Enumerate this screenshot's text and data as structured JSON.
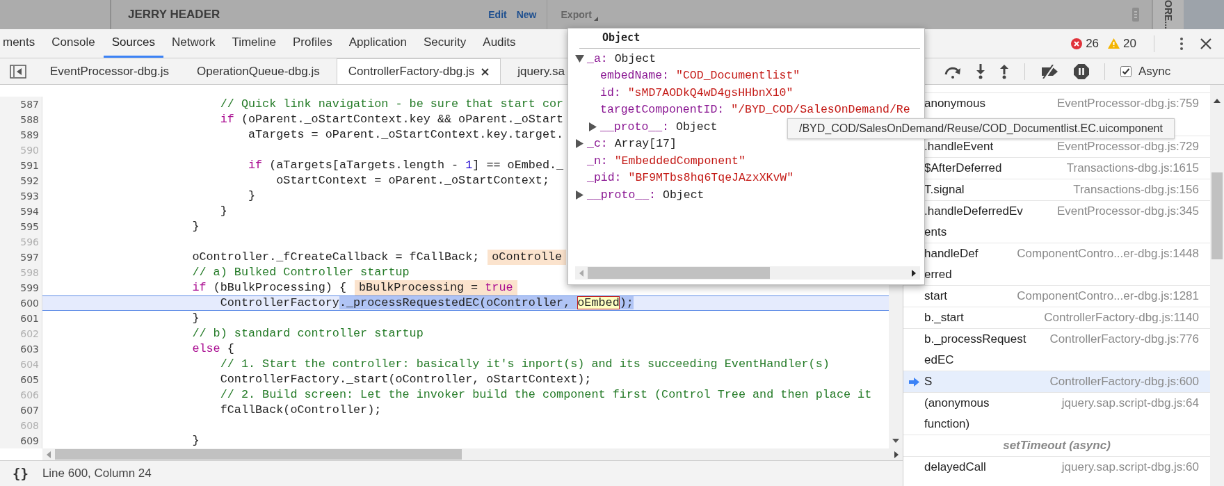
{
  "page_header": {
    "title": "JERRY HEADER",
    "actions": [
      "Edit",
      "New"
    ],
    "export": "Export",
    "side_label": "ORE..."
  },
  "panel_tabs": [
    {
      "label": "ments",
      "selected": false
    },
    {
      "label": "Console",
      "selected": false
    },
    {
      "label": "Sources",
      "selected": true
    },
    {
      "label": "Network",
      "selected": false
    },
    {
      "label": "Timeline",
      "selected": false
    },
    {
      "label": "Profiles",
      "selected": false
    },
    {
      "label": "Application",
      "selected": false
    },
    {
      "label": "Security",
      "selected": false
    },
    {
      "label": "Audits",
      "selected": false
    }
  ],
  "counts": {
    "errors": "26",
    "warnings": "20"
  },
  "file_tabs": [
    {
      "label": "EventProcessor-dbg.js",
      "selected": false
    },
    {
      "label": "OperationQueue-dbg.js",
      "selected": false
    },
    {
      "label": "ControllerFactory-dbg.js",
      "selected": true
    },
    {
      "label": "jquery.sa",
      "selected": false
    }
  ],
  "code_lines": [
    {
      "n": "587",
      "dim": false,
      "current": false,
      "code": [
        {
          "kind": "comment",
          "text": "                        // Quick link navigation - be sure that start cor"
        }
      ]
    },
    {
      "n": "588",
      "dim": false,
      "current": false,
      "code": [
        {
          "kind": "keyword",
          "text": "                        if"
        },
        {
          "kind": "plain",
          "text": " (oParent._oStartContext.key && oParent._oStart"
        }
      ]
    },
    {
      "n": "589",
      "dim": false,
      "current": false,
      "code": [
        {
          "kind": "plain",
          "text": "                            aTargets = oParent._oStartContext.key.target."
        }
      ]
    },
    {
      "n": "590",
      "dim": true,
      "current": false
    },
    {
      "n": "591",
      "dim": false,
      "current": false,
      "code": [
        {
          "kind": "keyword",
          "text": "                            if"
        },
        {
          "kind": "plain",
          "text": " (aTargets[aTargets.length - "
        },
        {
          "kind": "number",
          "text": "1"
        },
        {
          "kind": "plain",
          "text": "] == oEmbed._"
        }
      ]
    },
    {
      "n": "592",
      "dim": false,
      "current": false,
      "code": [
        {
          "kind": "plain",
          "text": "                                oStartContext = oParent._oStartContext;"
        }
      ]
    },
    {
      "n": "593",
      "dim": false,
      "current": false,
      "code": [
        {
          "kind": "plain",
          "text": "                            }"
        }
      ]
    },
    {
      "n": "594",
      "dim": false,
      "current": false,
      "code": [
        {
          "kind": "plain",
          "text": "                        }"
        }
      ]
    },
    {
      "n": "595",
      "dim": false,
      "current": false,
      "code": [
        {
          "kind": "plain",
          "text": "                    }"
        }
      ]
    },
    {
      "n": "596",
      "dim": true,
      "current": false
    },
    {
      "n": "597",
      "dim": false,
      "current": false,
      "code": [
        {
          "kind": "plain",
          "text": "                    oController._fCreateCallback = fCallBack;"
        }
      ],
      "inline": [
        {
          "kind": "plain",
          "text": "oControlle"
        }
      ]
    },
    {
      "n": "598",
      "dim": true,
      "current": false,
      "code": [
        {
          "kind": "comment",
          "text": "                    // a) Bulked Controller startup"
        }
      ]
    },
    {
      "n": "599",
      "dim": false,
      "current": false,
      "code": [
        {
          "kind": "keyword",
          "text": "                    if"
        },
        {
          "kind": "plain",
          "text": " (bBulkProcessing) {"
        }
      ],
      "inline": [
        {
          "kind": "plain",
          "text": "bBulkProcessing = "
        },
        {
          "kind": "keyword",
          "text": "true"
        }
      ]
    },
    {
      "n": "600",
      "dim": false,
      "current": true,
      "code": [
        {
          "kind": "plain",
          "text": "                        ControllerFactory"
        },
        {
          "kind": "selection",
          "text": "._processRequestedEC(oController, "
        },
        {
          "kind": "focus",
          "text": "oEmbed"
        },
        {
          "kind": "selection",
          "text": ");"
        }
      ]
    },
    {
      "n": "601",
      "dim": false,
      "current": false,
      "code": [
        {
          "kind": "plain",
          "text": "                    }"
        }
      ]
    },
    {
      "n": "602",
      "dim": true,
      "current": false,
      "code": [
        {
          "kind": "comment",
          "text": "                    // b) standard controller startup"
        }
      ]
    },
    {
      "n": "603",
      "dim": false,
      "current": false,
      "code": [
        {
          "kind": "keyword",
          "text": "                    else"
        },
        {
          "kind": "plain",
          "text": " {"
        }
      ]
    },
    {
      "n": "604",
      "dim": true,
      "current": false,
      "code": [
        {
          "kind": "comment",
          "text": "                        // 1. Start the controller: basically it's inport(s) and its succeeding EventHandler(s)"
        }
      ]
    },
    {
      "n": "605",
      "dim": false,
      "current": false,
      "code": [
        {
          "kind": "plain",
          "text": "                        ControllerFactory._start(oController, oStartContext);"
        }
      ]
    },
    {
      "n": "606",
      "dim": true,
      "current": false,
      "code": [
        {
          "kind": "comment",
          "text": "                        // 2. Build screen: Let the invoker build the component first (Control Tree and then place it"
        }
      ]
    },
    {
      "n": "607",
      "dim": false,
      "current": false,
      "code": [
        {
          "kind": "plain",
          "text": "                        fCallBack(oController);"
        }
      ]
    },
    {
      "n": "608",
      "dim": true,
      "current": false
    },
    {
      "n": "609",
      "dim": false,
      "current": false,
      "code": [
        {
          "kind": "plain",
          "text": "                    }"
        }
      ]
    }
  ],
  "status_bar": {
    "format_button": "{}",
    "position": "Line 600, Column 24"
  },
  "async": {
    "label": "Async",
    "checked": true
  },
  "call_stack": [
    {
      "kind": "frame",
      "name": [
        "anonymous"
      ],
      "location": "EventProcessor-dbg.js:759",
      "current": false
    },
    {
      "kind": "frame",
      "name": [
        ".handleEvent"
      ],
      "location": "EventProcessor-dbg.js:729",
      "current": false
    },
    {
      "kind": "frame",
      "name": [
        "$AfterDeferred"
      ],
      "location": "Transactions-dbg.js:1615",
      "current": false
    },
    {
      "kind": "frame",
      "name": [
        "T.signal"
      ],
      "location": "Transactions-dbg.js:156",
      "current": false
    },
    {
      "kind": "frame",
      "name": [
        ".handleDeferredEv",
        "ents"
      ],
      "location": "EventProcessor-dbg.js:345",
      "current": false
    },
    {
      "kind": "frame",
      "name": [
        "handleDef",
        "erred"
      ],
      "location": "ComponentContro...er-dbg.js:1448",
      "current": false
    },
    {
      "kind": "frame",
      "name": [
        "start"
      ],
      "location": "ComponentContro...er-dbg.js:1281",
      "current": false
    },
    {
      "kind": "frame",
      "name": [
        "b._start"
      ],
      "location": "ControllerFactory-dbg.js:1140",
      "current": false
    },
    {
      "kind": "frame",
      "name": [
        "b._processRequest",
        "edEC"
      ],
      "location": "ControllerFactory-dbg.js:776",
      "current": false
    },
    {
      "kind": "frame",
      "name": [
        "S"
      ],
      "location": "ControllerFactory-dbg.js:600",
      "current": true
    },
    {
      "kind": "frame",
      "name": [
        "(anonymous",
        "function)"
      ],
      "location": "jquery.sap.script-dbg.js:64",
      "current": false
    },
    {
      "kind": "async",
      "name": [
        "setTimeout (async)"
      ]
    },
    {
      "kind": "frame",
      "name": [
        "delayedCall"
      ],
      "location": "jquery.sap.script-dbg.js:60",
      "current": false
    }
  ],
  "popup": {
    "title": "Object",
    "tree": [
      {
        "key": "_a:",
        "value": "Object",
        "kind": "object",
        "expanded": true,
        "children": [
          {
            "key": "embedName:",
            "value": "\"COD_Documentlist\"",
            "kind": "string"
          },
          {
            "key": "id:",
            "value": "\"sMD7AODkQ4wD4gsHHbnX10\"",
            "kind": "string"
          },
          {
            "key": "targetComponentID:",
            "value": "\"/BYD_COD/SalesOnDemand/Re",
            "kind": "string"
          },
          {
            "key": "__proto__:",
            "value": "Object",
            "kind": "object",
            "expanded": false
          }
        ]
      },
      {
        "key": "_c:",
        "value": "Array[17]",
        "kind": "object",
        "expanded": false
      },
      {
        "key": "_n:",
        "value": "\"EmbeddedComponent\"",
        "kind": "string"
      },
      {
        "key": "_pid:",
        "value": "\"BF9MTbs8hq6TqeJAzxXKvW\"",
        "kind": "string"
      },
      {
        "key": "__proto__:",
        "value": "Object",
        "kind": "object",
        "expanded": false
      }
    ]
  },
  "tooltip": "/BYD_COD/SalesOnDemand/Reuse/COD_Documentlist.EC.uicomponent"
}
